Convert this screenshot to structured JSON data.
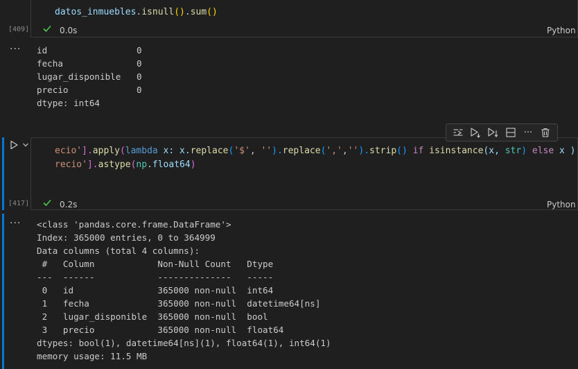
{
  "cell1": {
    "code_var": "datos_inmuebles",
    "code_dot1": ".",
    "code_fn1": "isnull",
    "code_paren1": "()",
    "code_dot2": ".",
    "code_fn2": "sum",
    "code_paren2": "()",
    "exec_count": "[409]",
    "status_time": "0.0s",
    "language": "Python",
    "output_ellipsis": "···",
    "output": "id                 0\nfecha              0\nlugar_disponible   0\nprecio             0\ndtype: int64"
  },
  "cell2": {
    "line1": {
      "a": "ecio'",
      "b": "].",
      "c": "apply",
      "d": "(",
      "e": "lambda",
      "f": " x: x.",
      "g": "replace",
      "h": "(",
      "i": "'$'",
      "j": ", ",
      "k": "''",
      "l": ").",
      "m": "replace",
      "n": "(",
      "o": "','",
      "p": ",",
      "q": "''",
      "r": ").",
      "s": "strip",
      "t": "() ",
      "u": "if",
      "v": " ",
      "w": "isinstance",
      "x": "(x, ",
      "y": "str",
      "z": ") ",
      "aa": "else",
      "ab": " x )"
    },
    "line2": {
      "a": "recio'",
      "b": "].",
      "c": "astype",
      "d": "(",
      "e": "np",
      "f": ".",
      "g": "float64",
      "h": ")"
    },
    "exec_count": "[417]",
    "status_time": "0.2s",
    "language": "Python",
    "output_ellipsis": "···",
    "output": "<class 'pandas.core.frame.DataFrame'>\nIndex: 365000 entries, 0 to 364999\nData columns (total 4 columns):\n #   Column            Non-Null Count   Dtype\n---  ------            --------------   -----\n 0   id                365000 non-null  int64\n 1   fecha             365000 non-null  datetime64[ns]\n 2   lugar_disponible  365000 non-null  bool\n 3   precio            365000 non-null  float64\ndtypes: bool(1), datetime64[ns](1), float64(1), int64(1)\nmemory usage: 11.5 MB"
  },
  "toolbar": {
    "icons": [
      "execute-above-icon",
      "execute-cell-and-below-icon",
      "execute-below-icon",
      "split-cell-icon",
      "more-actions-icon",
      "delete-cell-icon"
    ],
    "more_label": "···"
  },
  "colors": {
    "background": "#1f1f1f",
    "accent": "#0078d4",
    "success": "#4ec94e"
  }
}
